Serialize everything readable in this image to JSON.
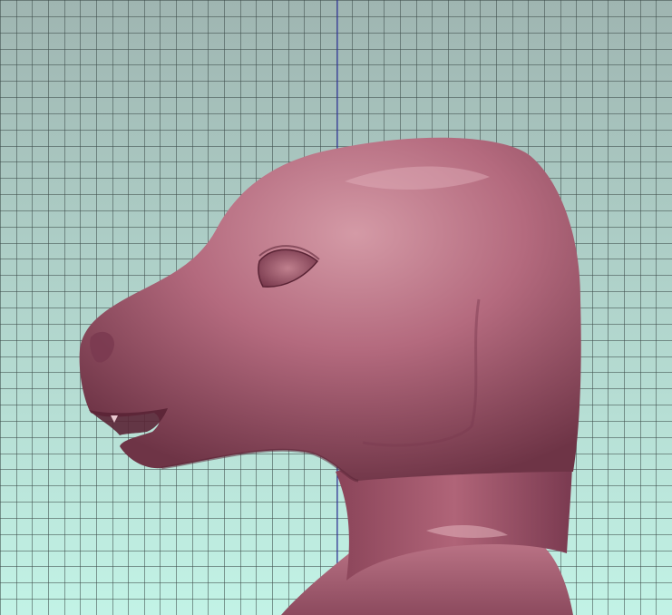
{
  "viewport": {
    "background_top_color": "#9fb5b1",
    "background_bottom_color": "#c2f3e6",
    "grid_color": "#3c4a48",
    "grid_cell_count_x": 42,
    "grid_cell_count_y": 38,
    "axis_line_color": "#2a2aa8"
  },
  "model": {
    "name": "sculpted-creature-head",
    "base_color": "#a45a70",
    "highlight_color": "#d49aa6",
    "shadow_color": "#6e3446",
    "mouth_color": "#5a2435"
  }
}
